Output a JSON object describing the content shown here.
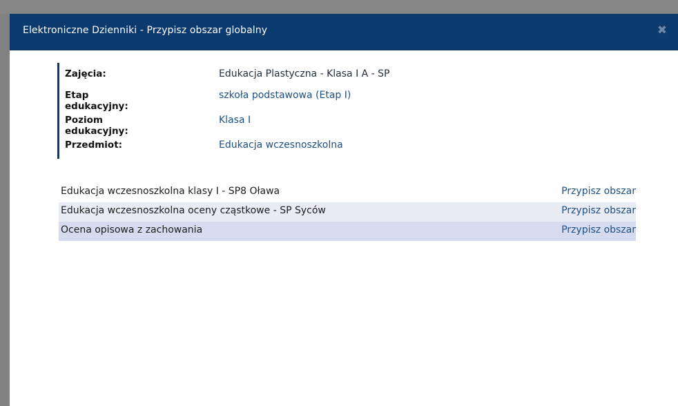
{
  "modal": {
    "title": "Elektroniczne Dzienniki - Przypisz obszar globalny",
    "close_icon": "close-icon"
  },
  "info": [
    {
      "label": "Zajęcia:",
      "value": "Edukacja Plastyczna - Klasa I A - SP",
      "link": false
    },
    {
      "label": "Etap edukacyjny:",
      "value": "szkoła podstawowa (Etap I)",
      "link": true
    },
    {
      "label": "Poziom edukacyjny:",
      "value": "Klasa I",
      "link": true
    },
    {
      "label": "Przedmiot:",
      "value": "Edukacja wczesnoszkolna",
      "link": true
    }
  ],
  "areas": [
    {
      "name": "Edukacja wczesnoszkolna klasy I - SP8 Oława",
      "action": "Przypisz obszar"
    },
    {
      "name": "Edukacja wczesnoszkolna oceny cząstkowe - SP Syców",
      "action": "Przypisz obszar"
    },
    {
      "name": "Ocena opisowa z zachowania",
      "action": "Przypisz obszar"
    }
  ],
  "colors": {
    "titlebar": "#0b3a6e",
    "link": "#1c4f86",
    "row_alt": "#eaecf5",
    "row_selected": "#d6dbef"
  }
}
